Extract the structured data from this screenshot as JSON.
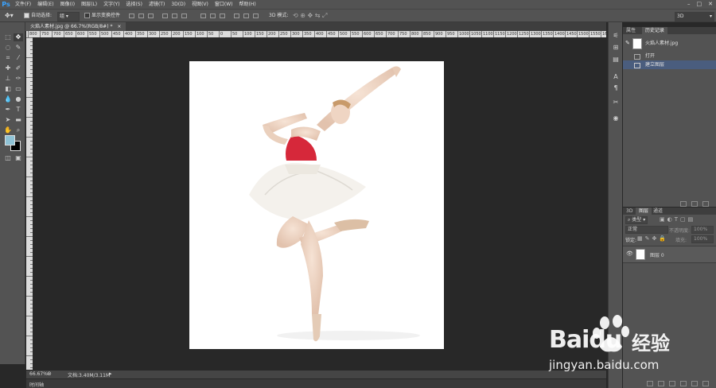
{
  "app": {
    "logo": "Ps"
  },
  "menubar": {
    "items": [
      "文件(F)",
      "编辑(E)",
      "图像(I)",
      "图层(L)",
      "文字(Y)",
      "选择(S)",
      "滤镜(T)",
      "3D(D)",
      "视图(V)",
      "窗口(W)",
      "帮助(H)"
    ],
    "window_controls": [
      "–",
      "□",
      "✕"
    ]
  },
  "options": {
    "auto_select_label": "自动选择:",
    "auto_select_value": "组",
    "show_transform_label": "显示变换控件",
    "mode_3d_label": "3D 模式:",
    "workspace_value": "3D"
  },
  "document": {
    "tab_title": "火焰人素材.jpg @ 66.7%(RGB/8#) *",
    "zoom": "66.67%",
    "doc_info": "文档:3.40M/3.11M"
  },
  "ruler": {
    "top_ticks": [
      "800",
      "750",
      "700",
      "650",
      "600",
      "550",
      "500",
      "450",
      "400",
      "350",
      "300",
      "250",
      "200",
      "150",
      "100",
      "50",
      "0",
      "50",
      "100",
      "150",
      "200",
      "250",
      "300",
      "350",
      "400",
      "450",
      "500",
      "550",
      "600",
      "650",
      "700",
      "750",
      "800",
      "850",
      "900",
      "950",
      "1000",
      "1050",
      "1100",
      "1150",
      "1200",
      "1250",
      "1300",
      "1350",
      "1400",
      "1450",
      "1500",
      "1550",
      "1600"
    ]
  },
  "panels": {
    "history_tabs": [
      "属性",
      "历史记录"
    ],
    "history_snapshot": "火焰人素材.jpg",
    "history_items": [
      "打开",
      "建立图层"
    ],
    "layers_tabs": [
      "3D",
      "图层",
      "通道"
    ],
    "layers_kind": "类型",
    "blend_mode": "正常",
    "opacity_label": "不透明度:",
    "opacity_value": "100%",
    "lock_label": "锁定:",
    "fill_label": "填充:",
    "fill_value": "100%",
    "layer_name": "图层 0"
  },
  "timeline": {
    "label": "时间轴"
  },
  "watermark": {
    "brand": "Baidu",
    "cn": "经验",
    "url": "jingyan.baidu.com"
  },
  "colors": {
    "foreground": "#8fc3d6",
    "background": "#000000",
    "dress_red": "#d6283a"
  }
}
